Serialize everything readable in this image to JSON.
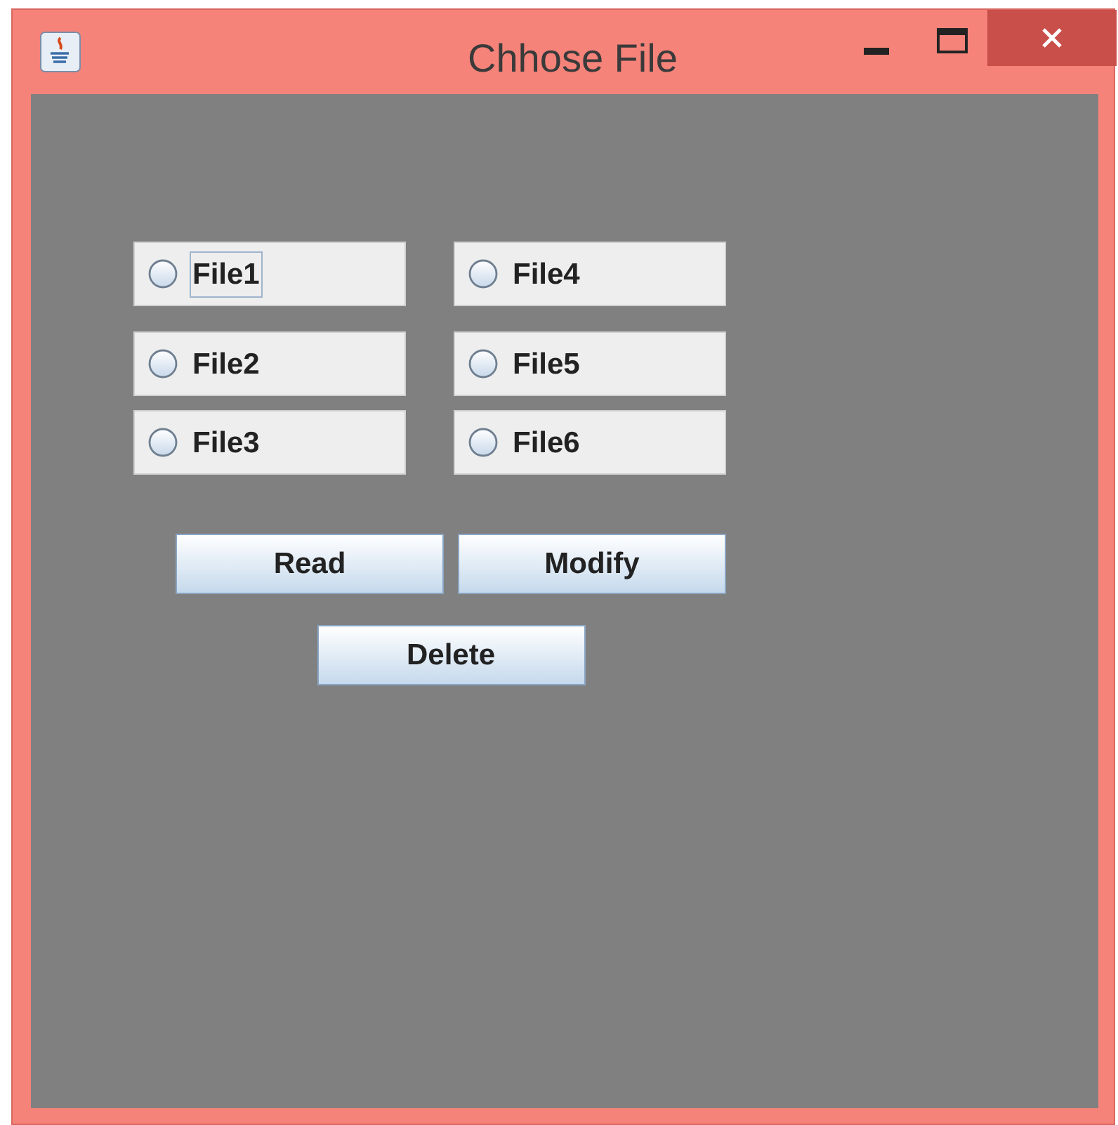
{
  "window": {
    "title": "Chhose File"
  },
  "radio_columns": [
    [
      {
        "label": "File1",
        "selected": false,
        "focused": true
      },
      {
        "label": "File2",
        "selected": false,
        "focused": false
      },
      {
        "label": "File3",
        "selected": false,
        "focused": false
      }
    ],
    [
      {
        "label": "File4",
        "selected": false,
        "focused": false
      },
      {
        "label": "File5",
        "selected": false,
        "focused": false
      },
      {
        "label": "File6",
        "selected": false,
        "focused": false
      }
    ]
  ],
  "buttons": [
    "Read",
    "Modify",
    "Delete"
  ]
}
